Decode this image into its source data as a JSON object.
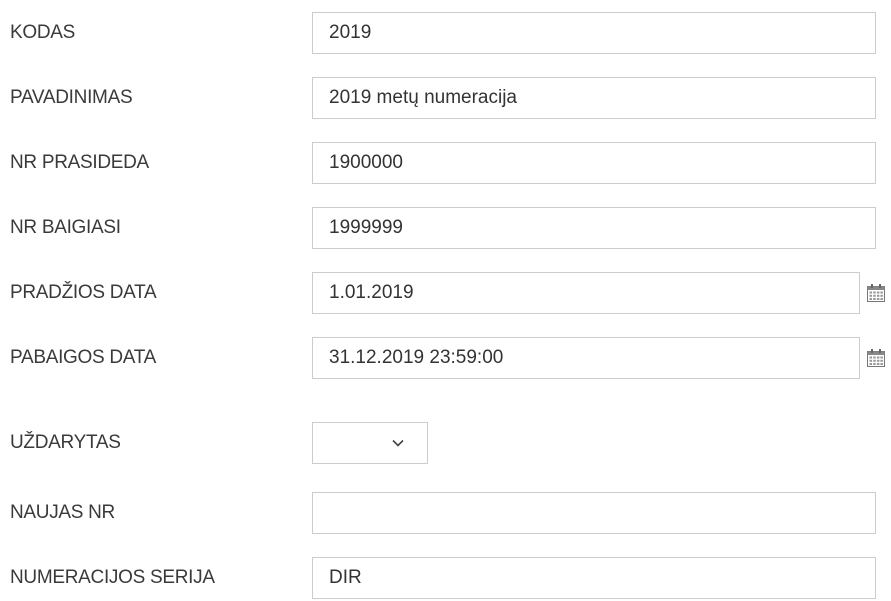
{
  "fields": [
    {
      "label": "KODAS",
      "value": "2019"
    },
    {
      "label": "PAVADINIMAS",
      "value": "2019 metų numeracija"
    },
    {
      "label": "NR PRASIDEDA",
      "value": "1900000"
    },
    {
      "label": "NR BAIGIASI",
      "value": "1999999"
    },
    {
      "label": "PRADŽIOS DATA",
      "value": "1.01.2019",
      "icon": "calendar-icon"
    },
    {
      "label": "PABAIGOS DATA",
      "value": "31.12.2019 23:59:00",
      "icon": "calendar-icon"
    },
    {
      "label": "UŽDARYTAS",
      "value": "",
      "icon": "chevron-down-icon"
    },
    {
      "label": "NAUJAS NR",
      "value": ""
    },
    {
      "label": "NUMERACIJOS SERIJA",
      "value": "DIR"
    }
  ]
}
